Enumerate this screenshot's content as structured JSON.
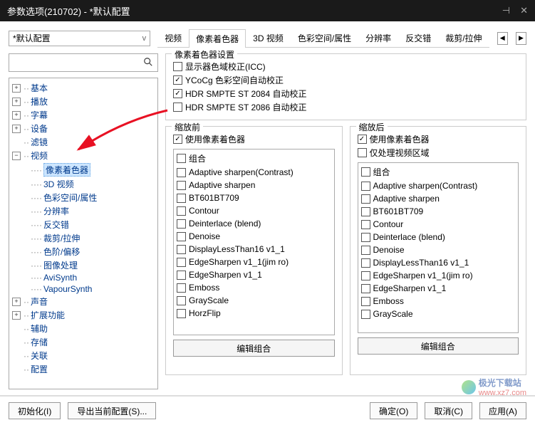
{
  "window": {
    "title": "参数选项(210702) - *默认配置"
  },
  "profile": {
    "selected": "*默认配置"
  },
  "tabs": {
    "items": [
      "视频",
      "像素着色器",
      "3D 视频",
      "色彩空间/属性",
      "分辨率",
      "反交错",
      "裁剪/拉伸"
    ],
    "active": "像素着色器"
  },
  "search": {
    "placeholder": ""
  },
  "tree": {
    "items": [
      {
        "label": "基本",
        "type": "exp"
      },
      {
        "label": "播放",
        "type": "exp"
      },
      {
        "label": "字幕",
        "type": "exp"
      },
      {
        "label": "设备",
        "type": "exp"
      },
      {
        "label": "滤镜",
        "type": "leaf"
      },
      {
        "label": "视频",
        "type": "open",
        "children": [
          {
            "label": "像素着色器",
            "selected": true
          },
          {
            "label": "3D 视频"
          },
          {
            "label": "色彩空间/属性"
          },
          {
            "label": "分辨率"
          },
          {
            "label": "反交错"
          },
          {
            "label": "裁剪/拉伸"
          },
          {
            "label": "色阶/偏移"
          },
          {
            "label": "图像处理"
          },
          {
            "label": "AviSynth"
          },
          {
            "label": "VapourSynth"
          }
        ]
      },
      {
        "label": "声音",
        "type": "exp"
      },
      {
        "label": "扩展功能",
        "type": "exp"
      },
      {
        "label": "辅助",
        "type": "leaf"
      },
      {
        "label": "存储",
        "type": "leaf"
      },
      {
        "label": "关联",
        "type": "leaf"
      },
      {
        "label": "配置",
        "type": "leaf"
      }
    ]
  },
  "settings_group": {
    "title": "像素着色器设置",
    "items": [
      {
        "label": "显示器色域校正(ICC)",
        "checked": false
      },
      {
        "label": "YCoCg 色彩空间自动校正",
        "checked": true
      },
      {
        "label": "HDR SMPTE ST 2084 自动校正",
        "checked": true
      },
      {
        "label": "HDR SMPTE ST 2086 自动校正",
        "checked": false
      }
    ]
  },
  "before": {
    "title": "缩放前",
    "use_label": "使用像素着色器",
    "use_checked": true,
    "items": [
      {
        "label": "组合"
      },
      {
        "label": "Adaptive sharpen(Contrast)"
      },
      {
        "label": "Adaptive sharpen"
      },
      {
        "label": "BT601BT709"
      },
      {
        "label": "Contour"
      },
      {
        "label": "Deinterlace (blend)"
      },
      {
        "label": "Denoise"
      },
      {
        "label": "DisplayLessThan16 v1_1"
      },
      {
        "label": "EdgeSharpen v1_1(jim ro)"
      },
      {
        "label": "EdgeSharpen v1_1"
      },
      {
        "label": "Emboss"
      },
      {
        "label": "GrayScale"
      },
      {
        "label": "HorzFlip"
      }
    ],
    "edit_label": "编辑组合"
  },
  "after": {
    "title": "缩放后",
    "use_label": "使用像素着色器",
    "use_checked": true,
    "only_video_label": "仅处理视频区域",
    "only_video_checked": false,
    "items": [
      {
        "label": "组合"
      },
      {
        "label": "Adaptive sharpen(Contrast)"
      },
      {
        "label": "Adaptive sharpen"
      },
      {
        "label": "BT601BT709"
      },
      {
        "label": "Contour"
      },
      {
        "label": "Deinterlace (blend)"
      },
      {
        "label": "Denoise"
      },
      {
        "label": "DisplayLessThan16 v1_1"
      },
      {
        "label": "EdgeSharpen v1_1(jim ro)"
      },
      {
        "label": "EdgeSharpen v1_1"
      },
      {
        "label": "Emboss"
      },
      {
        "label": "GrayScale"
      }
    ],
    "edit_label": "编辑组合"
  },
  "footer": {
    "init": "初始化(I)",
    "export": "导出当前配置(S)...",
    "ok": "确定(O)",
    "cancel": "取消(C)",
    "apply": "应用(A)"
  },
  "watermark": {
    "name": "极光下载站",
    "url": "www.xz7.com"
  }
}
